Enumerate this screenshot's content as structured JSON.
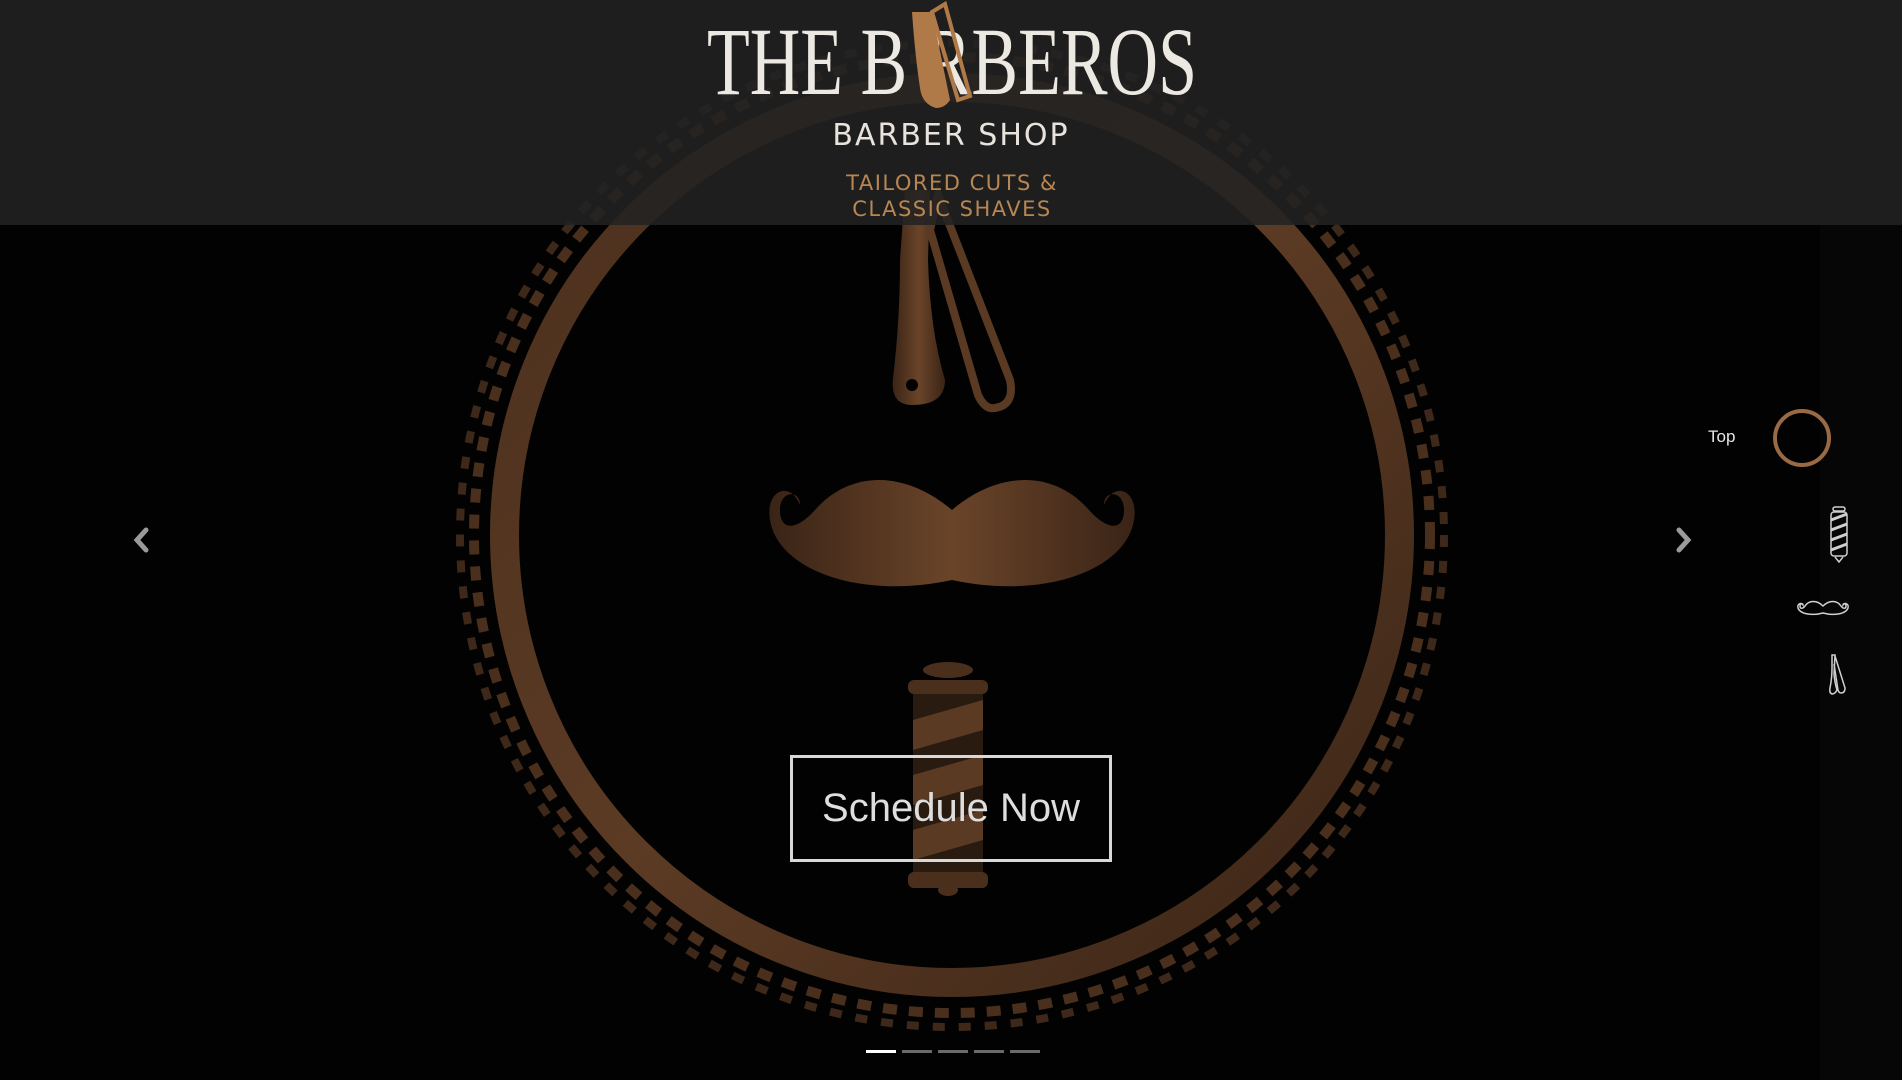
{
  "brand": {
    "logo_text": "THE BARBEROS",
    "subtitle": "BARBER SHOP",
    "tagline_line1": "TAILORED CUTS &",
    "tagline_line2": "CLASSIC SHAVES"
  },
  "hero": {
    "cta_label": "Schedule Now"
  },
  "side_nav": {
    "top_label": "Top",
    "items": [
      "top-circle-icon",
      "barber-pole-icon",
      "mustache-icon",
      "razor-icon"
    ]
  },
  "carousel": {
    "slide_count": 5,
    "active_index": 0,
    "prev_icon": "chevron-left-icon",
    "next_icon": "chevron-right-icon"
  },
  "colors": {
    "accent_copper": "#b78652",
    "header_bg": "#222222",
    "page_bg": "#020202",
    "text_light": "#e8e3dc"
  }
}
